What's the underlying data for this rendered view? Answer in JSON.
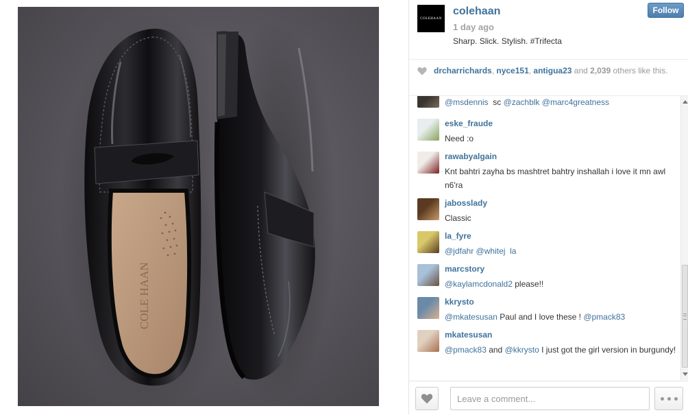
{
  "post": {
    "brand_avatar_text": "COLEHAAN",
    "username": "colehaan",
    "timestamp": "1 day ago",
    "caption": "Sharp. Slick. Stylish. #Trifecta",
    "follow_label": "Follow"
  },
  "photo": {
    "description_icon": "shoe-photo",
    "insole_logo": "COLE HAAN"
  },
  "likes": {
    "users": [
      "drcharrichards",
      "nyce151",
      "antigua23"
    ],
    "sep1": ", ",
    "sep2": ", ",
    "and_text": " and ",
    "count": "2,039",
    "others_text": " others like this."
  },
  "comments": [
    {
      "user": "",
      "parts": [
        {
          "t": "@msdennis",
          "m": true
        },
        {
          "t": "  sc ",
          "m": false
        },
        {
          "t": "@zachblk",
          "m": true
        },
        {
          "t": " ",
          "m": false
        },
        {
          "t": "@marc4greatness",
          "m": true
        }
      ]
    },
    {
      "user": "eske_fraude",
      "parts": [
        {
          "t": "Need :o",
          "m": false
        }
      ]
    },
    {
      "user": "rawabyalgain",
      "parts": [
        {
          "t": "Knt bahtri zayha bs mashtret bahtry inshallah i love it mn awl n6'ra",
          "m": false
        }
      ]
    },
    {
      "user": "jabosslady",
      "parts": [
        {
          "t": "Classic",
          "m": false
        }
      ]
    },
    {
      "user": "la_fyre",
      "parts": [
        {
          "t": "@jdfahr",
          "m": true
        },
        {
          "t": " ",
          "m": false
        },
        {
          "t": "@whitej",
          "m": true
        },
        {
          "t": "  ",
          "m": false
        },
        {
          "t": "la",
          "m": true
        }
      ]
    },
    {
      "user": "marcstory",
      "parts": [
        {
          "t": "@kaylamcdonald2",
          "m": true
        },
        {
          "t": " please!!",
          "m": false
        }
      ]
    },
    {
      "user": "kkrysto",
      "parts": [
        {
          "t": "@mkatesusan",
          "m": true
        },
        {
          "t": " Paul and I love these ! ",
          "m": false
        },
        {
          "t": "@pmack83",
          "m": true
        }
      ]
    },
    {
      "user": "mkatesusan",
      "parts": [
        {
          "t": "@pmack83",
          "m": true
        },
        {
          "t": " and ",
          "m": false
        },
        {
          "t": "@kkrysto",
          "m": true
        },
        {
          "t": " I just got the girl version in burgundy!",
          "m": false
        }
      ]
    }
  ],
  "footer": {
    "comment_placeholder": "Leave a comment..."
  },
  "colors": {
    "link_blue": "#3f729b",
    "muted_gray": "#a4a4a4",
    "follow_blue": "#5a8bbb"
  }
}
